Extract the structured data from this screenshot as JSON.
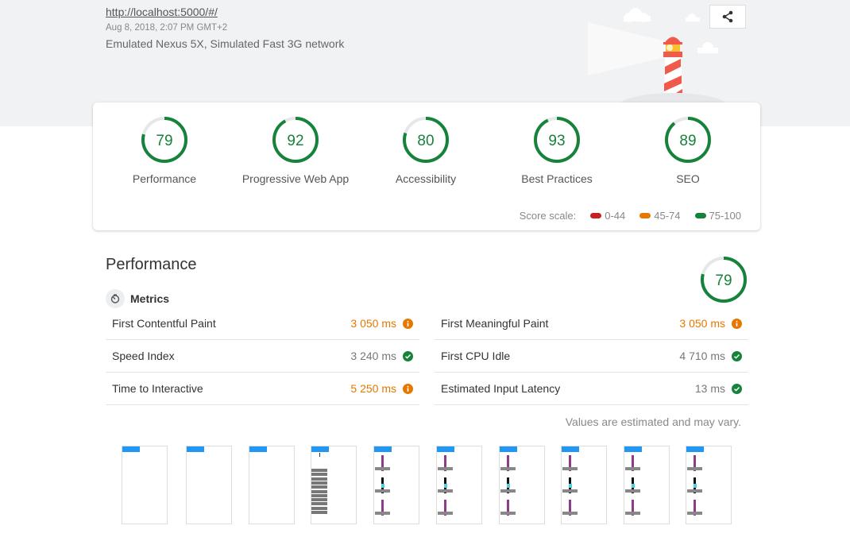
{
  "header": {
    "url": "http://localhost:5000/#/",
    "date": "Aug 8, 2018, 2:07 PM GMT+2",
    "environment": "Emulated Nexus 5X, Simulated Fast 3G network",
    "share_icon": "share-icon"
  },
  "colors": {
    "pass": "#178239",
    "average": "#e67700",
    "fail": "#c7221f",
    "track": "#e6e7ea"
  },
  "categories": [
    {
      "label": "Performance",
      "score": 79
    },
    {
      "label": "Progressive Web App",
      "score": 92
    },
    {
      "label": "Accessibility",
      "score": 80
    },
    {
      "label": "Best Practices",
      "score": 93
    },
    {
      "label": "SEO",
      "score": 89
    }
  ],
  "score_scale": {
    "label": "Score scale:",
    "ranges": [
      {
        "label": "0-44",
        "color": "#c7221f"
      },
      {
        "label": "45-74",
        "color": "#e67700"
      },
      {
        "label": "75-100",
        "color": "#178239"
      }
    ]
  },
  "performance": {
    "title": "Performance",
    "score": 79,
    "metrics_label": "Metrics",
    "metrics_left": [
      {
        "name": "First Contentful Paint",
        "value": "3 050 ms",
        "status": "average"
      },
      {
        "name": "Speed Index",
        "value": "3 240 ms",
        "status": "pass"
      },
      {
        "name": "Time to Interactive",
        "value": "5 250 ms",
        "status": "average"
      }
    ],
    "metrics_right": [
      {
        "name": "First Meaningful Paint",
        "value": "3 050 ms",
        "status": "average"
      },
      {
        "name": "First CPU Idle",
        "value": "4 710 ms",
        "status": "pass"
      },
      {
        "name": "Estimated Input Latency",
        "value": "13 ms",
        "status": "pass"
      }
    ],
    "note": "Values are estimated and may vary.",
    "filmstrip_frames": [
      "blank",
      "blank",
      "blank",
      "list",
      "content",
      "content",
      "content",
      "content",
      "content",
      "content"
    ]
  }
}
